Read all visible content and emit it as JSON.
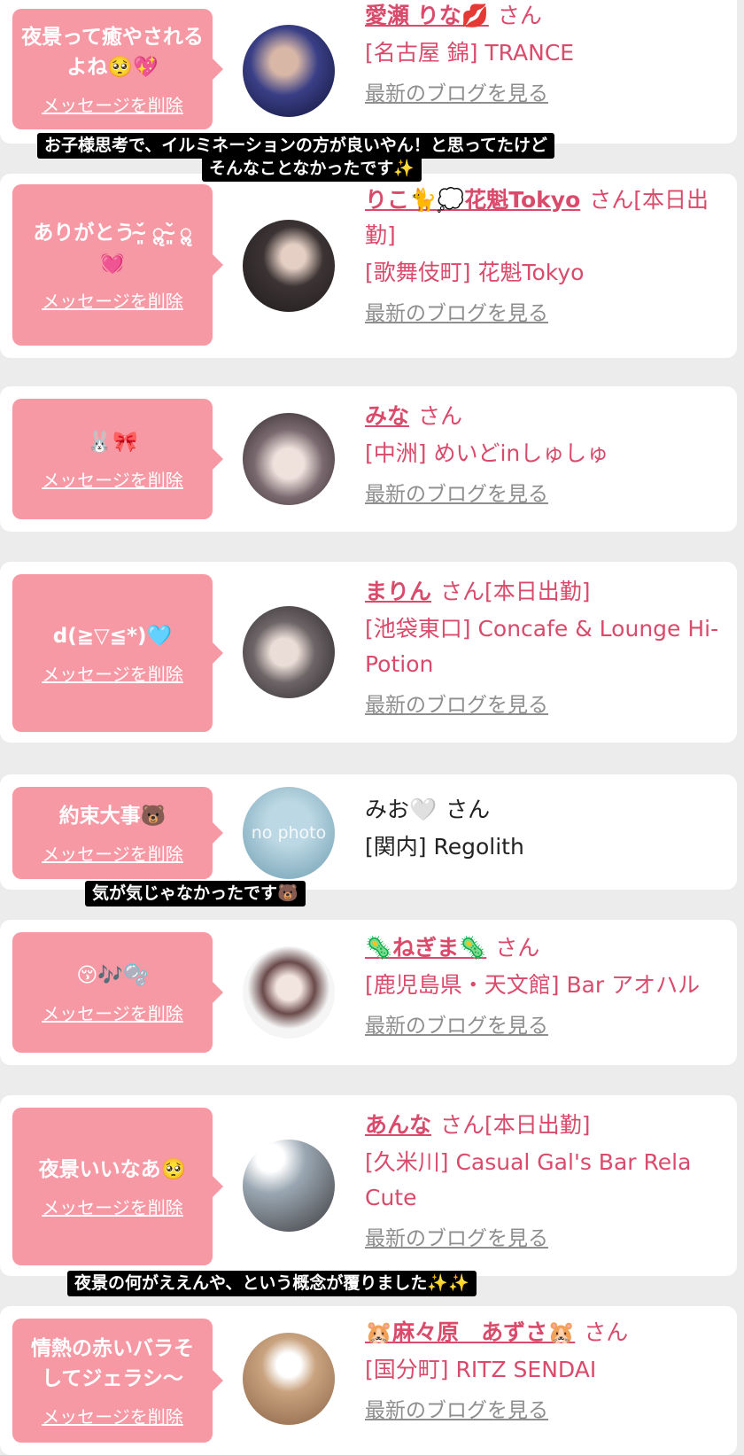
{
  "delete_label": "メッセージを削除",
  "blog_label": "最新のブログを見る",
  "san": "さん",
  "entries": [
    {
      "message": "夜景って癒やされるよね🥺💖",
      "name": "愛瀬 りな💋",
      "status": "",
      "shop": "[名古屋 錦] TRANCE",
      "blog": true
    },
    {
      "message": "ありがとう˘̴͈́ ॢ˘̴͈̀ ॢ 💓",
      "name": "りこ🐈💭花魁Tokyo",
      "status": "[本日出勤]",
      "shop": "[歌舞伎町] 花魁Tokyo",
      "blog": true
    },
    {
      "message": "🐰🎀",
      "name": "みな",
      "status": "",
      "shop": "[中洲] めいどinしゅしゅ",
      "blog": true
    },
    {
      "message": "d(≧▽≦*)🩵",
      "name": "まりん",
      "status": "[本日出勤]",
      "shop": "[池袋東口] Concafe & Lounge Hi-Potion",
      "blog": true
    },
    {
      "message": "約束大事🐻",
      "name": "みお🤍",
      "status": "",
      "shop": "[関内] Regolith",
      "blog": false,
      "avatar_text": "no photo"
    },
    {
      "message": "😚🎶🫧",
      "name": "🦠ねぎま🦠",
      "status": "",
      "shop": "[鹿児島県・天文館] Bar アオハル",
      "blog": true
    },
    {
      "message": "夜景いいなあ🥺",
      "name": "あんな",
      "status": "[本日出勤]",
      "shop": "[久米川] Casual Gal's Bar Rela Cute",
      "blog": true
    },
    {
      "message": "情熱の赤いバラそしてジェラシ〜",
      "name": "🐹麻々原　あずさ🐹",
      "status": "",
      "shop": "[国分町] RITZ SENDAI",
      "blog": true
    }
  ],
  "captions": [
    {
      "line1": "お子様思考で、イルミネーションの方が良いやん！と思ってたけど",
      "line2": "そんなことなかったです✨"
    },
    {
      "line1": "気が気じゃなかったです🐻"
    },
    {
      "line1": "夜景の何がええんや、という概念が覆りました✨✨"
    }
  ],
  "colors": {
    "accent": "#f799a4",
    "link": "#d94a6b",
    "muted": "#8e8e8e"
  }
}
